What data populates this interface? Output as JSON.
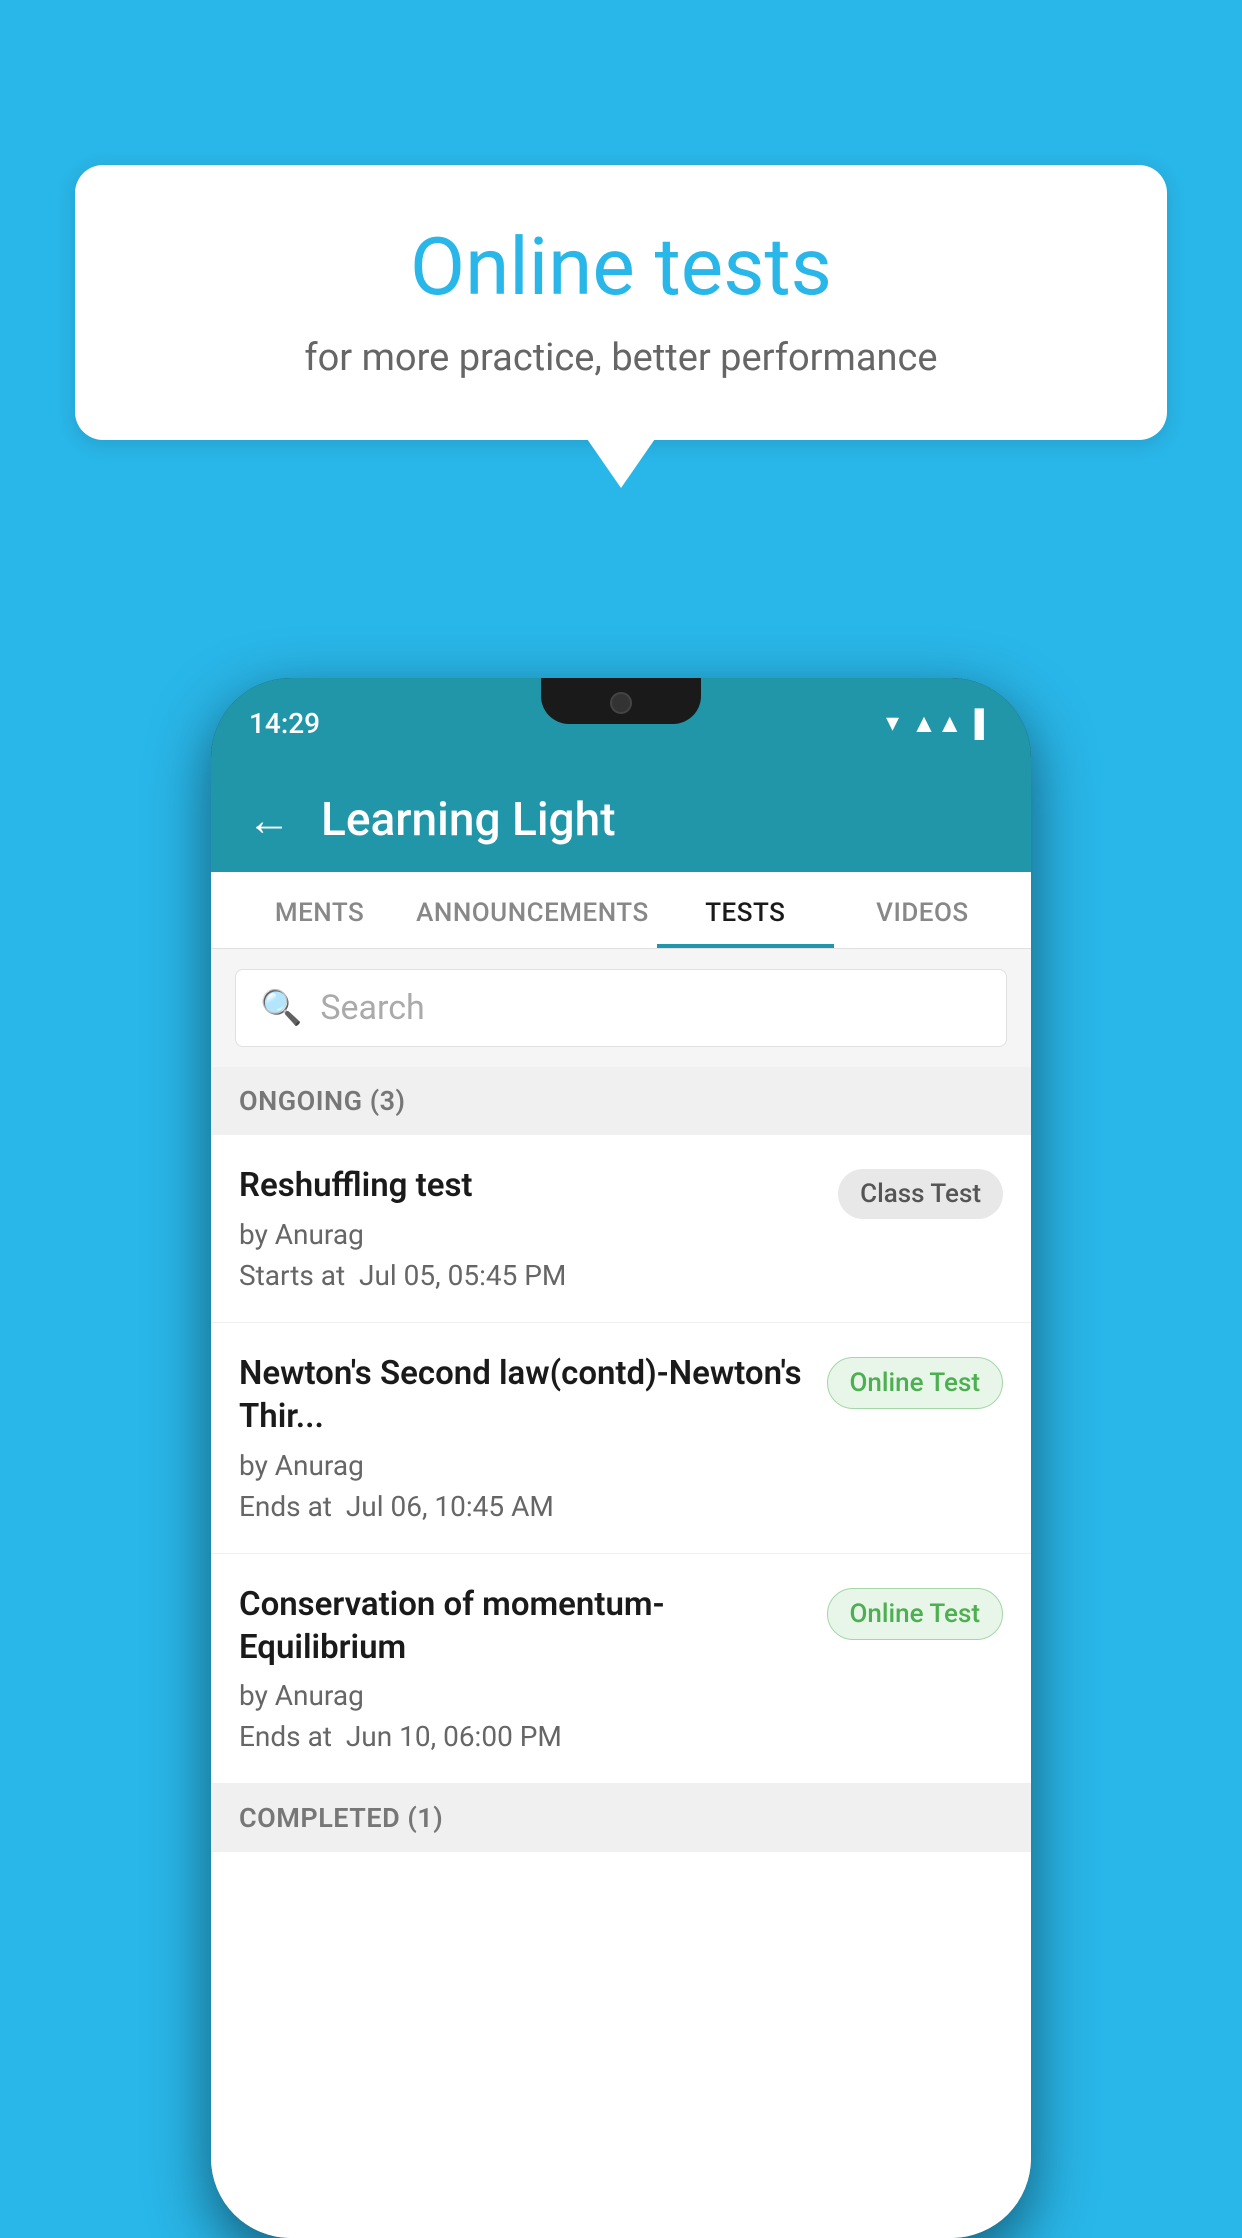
{
  "background": {
    "color": "#29b6e8"
  },
  "promo": {
    "title": "Online tests",
    "subtitle": "for more practice, better performance"
  },
  "phone": {
    "status_time": "14:29",
    "app_title": "Learning Light",
    "back_label": "←",
    "tabs": [
      {
        "label": "MENTS",
        "active": false
      },
      {
        "label": "ANNOUNCEMENTS",
        "active": false
      },
      {
        "label": "TESTS",
        "active": true
      },
      {
        "label": "VIDEOS",
        "active": false
      }
    ],
    "search_placeholder": "Search",
    "section_ongoing": "ONGOING (3)",
    "tests": [
      {
        "name": "Reshuffling test",
        "by": "by Anurag",
        "time_label": "Starts at",
        "time": "Jul 05, 05:45 PM",
        "badge": "Class Test",
        "badge_type": "class"
      },
      {
        "name": "Newton's Second law(contd)-Newton's Thir...",
        "by": "by Anurag",
        "time_label": "Ends at",
        "time": "Jul 06, 10:45 AM",
        "badge": "Online Test",
        "badge_type": "online"
      },
      {
        "name": "Conservation of momentum-Equilibrium",
        "by": "by Anurag",
        "time_label": "Ends at",
        "time": "Jun 10, 06:00 PM",
        "badge": "Online Test",
        "badge_type": "online"
      }
    ],
    "section_completed": "COMPLETED (1)"
  }
}
